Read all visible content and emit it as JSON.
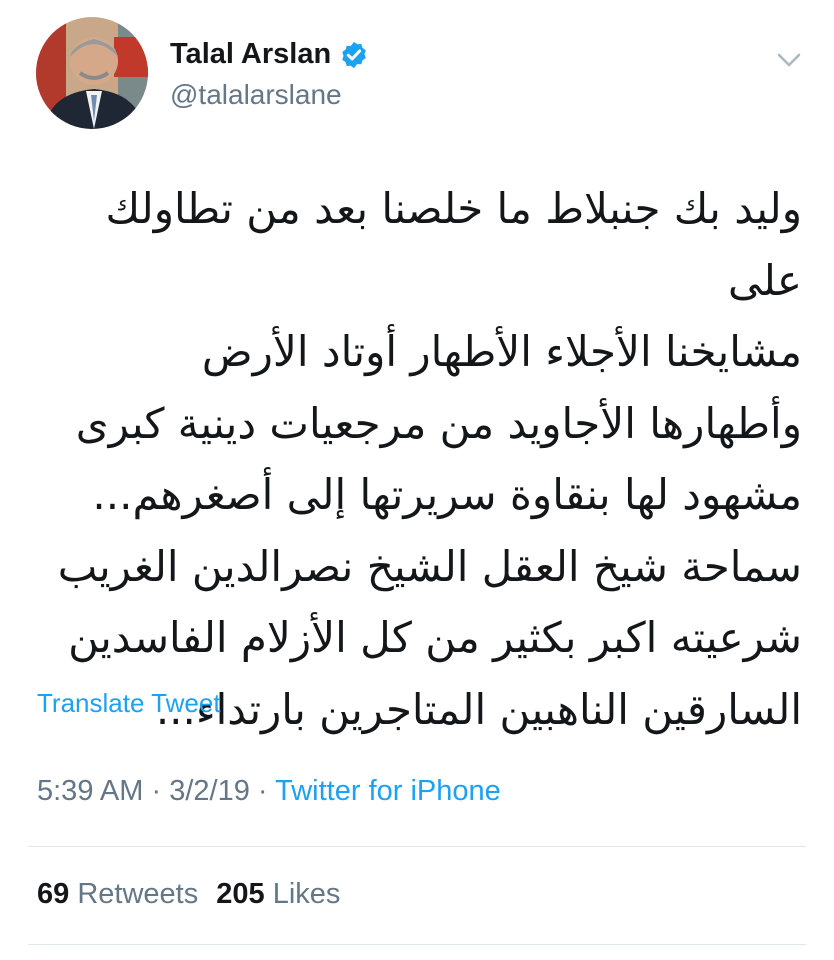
{
  "author": {
    "display_name": "Talal Arslan",
    "handle": "@talalarslane",
    "verified": true
  },
  "tweet": {
    "text_lines": [
      "وليد بك جنبلاط ما خلصنا بعد من تطاولك على",
      "مشايخنا الأجلاء الأطهار أوتاد الأرض",
      "وأطهارها الأجاويد من مرجعيات دينية كبرى",
      "مشهود لها بنقاوة سريرتها إلى أصغرهم...",
      "سماحة شيخ العقل الشيخ نصرالدين الغريب",
      "شرعيته اكبر بكثير من كل الأزلام الفاسدين",
      "السارقين الناهبين المتاجرين بارتداء..."
    ],
    "translate_label": "Translate Tweet",
    "time": "5:39 AM",
    "date": "3/2/19",
    "separator": "·",
    "source": "Twitter for iPhone"
  },
  "stats": {
    "retweets_count": "69",
    "retweets_label": "Retweets",
    "likes_count": "205",
    "likes_label": "Likes"
  },
  "icons": {
    "verified": "verified-badge-icon",
    "caret": "chevron-down-icon"
  },
  "colors": {
    "link_blue": "#1da1f2",
    "secondary_gray": "#657786",
    "text": "#14171a",
    "divider": "#e1e8ed"
  }
}
